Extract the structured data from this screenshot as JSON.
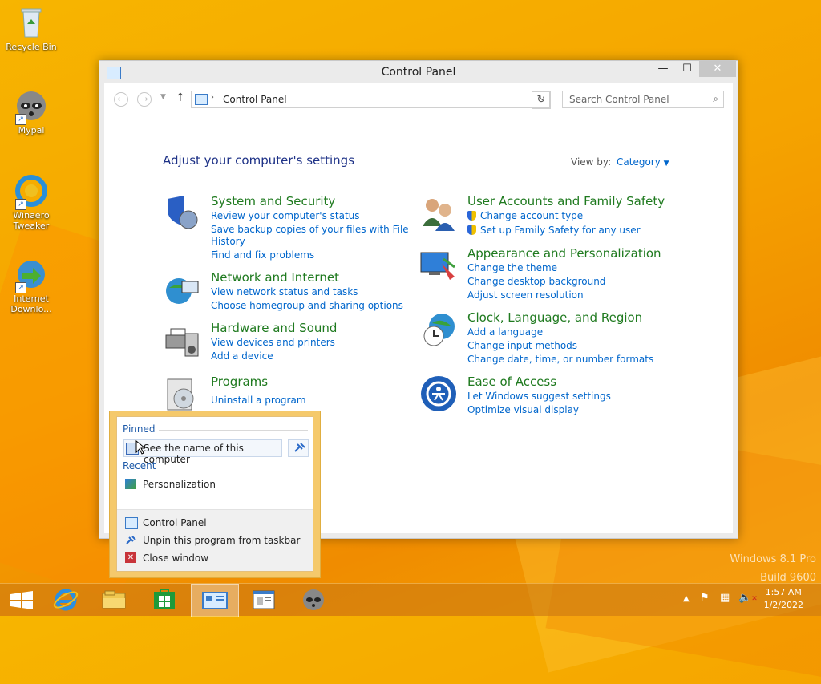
{
  "desktop": {
    "icons": [
      {
        "label": "Recycle Bin"
      },
      {
        "label": "Mypal"
      },
      {
        "label": "Winaero Tweaker"
      },
      {
        "label": "Internet Downlo..."
      }
    ],
    "watermark": {
      "line1": "Windows 8.1 Pro",
      "line2": "Build 9600"
    }
  },
  "window": {
    "title": "Control Panel",
    "controls": {
      "minimize": "—",
      "maximize": "☐",
      "close": "✕"
    },
    "address": {
      "crumb": "Control Panel"
    },
    "search": {
      "placeholder": "Search Control Panel"
    },
    "heading": "Adjust your computer's settings",
    "view_by": {
      "label": "View by:",
      "value": "Category"
    },
    "categories": [
      {
        "title": "System and Security",
        "links": [
          "Review your computer's status",
          "Save backup copies of your files with File",
          "History",
          "Find and fix problems"
        ]
      },
      {
        "title": "Network and Internet",
        "links": [
          "View network status and tasks",
          "Choose homegroup and sharing options"
        ]
      },
      {
        "title": "Hardware and Sound",
        "links": [
          "View devices and printers",
          "Add a device"
        ]
      },
      {
        "title": "Programs",
        "links": [
          "Uninstall a program"
        ]
      },
      {
        "title": "User Accounts and Family Safety",
        "links": [
          "Change account type",
          "Set up Family Safety for any user"
        ]
      },
      {
        "title": "Appearance and Personalization",
        "links": [
          "Change the theme",
          "Change desktop background",
          "Adjust screen resolution"
        ]
      },
      {
        "title": "Clock, Language, and Region",
        "links": [
          "Add a language",
          "Change input methods",
          "Change date, time, or number formats"
        ]
      },
      {
        "title": "Ease of Access",
        "links": [
          "Let Windows suggest settings",
          "Optimize visual display"
        ]
      }
    ]
  },
  "jumplist": {
    "pinned_label": "Pinned",
    "pinned_item": "See the name of this computer",
    "recent_label": "Recent",
    "recent_item": "Personalization",
    "tasks": [
      "Control Panel",
      "Unpin this program from taskbar",
      "Close window"
    ]
  },
  "taskbar": {
    "clock": {
      "time": "1:57 AM",
      "date": "1/2/2022"
    }
  },
  "colors": {
    "accent_orange": "#f5a300",
    "link_blue": "#0066cc",
    "category_green": "#1f7a1f",
    "heading_navy": "#1e3287"
  }
}
